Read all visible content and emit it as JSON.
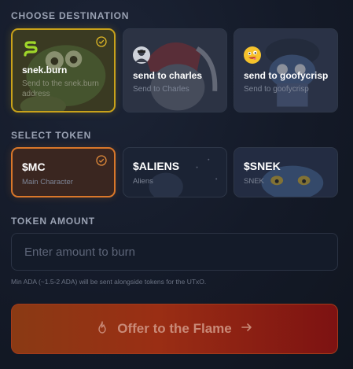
{
  "destination": {
    "section_label": "CHOOSE DESTINATION",
    "cards": [
      {
        "title": "snek.burn",
        "subtitle": "Send to the snek.burn address",
        "selected": true,
        "avatar_icon": "snake-icon"
      },
      {
        "title": "send to charles",
        "subtitle": "Send to Charles",
        "selected": false,
        "avatar_icon": "charles-avatar-icon"
      },
      {
        "title": "send to goofycrisp",
        "subtitle": "Send to goofycrisp",
        "selected": false,
        "avatar_icon": "goofy-face-icon"
      }
    ]
  },
  "token": {
    "section_label": "SELECT TOKEN",
    "cards": [
      {
        "title": "$MC",
        "subtitle": "Main Character",
        "selected": true
      },
      {
        "title": "$ALIENS",
        "subtitle": "Aliens",
        "selected": false
      },
      {
        "title": "$SNEK",
        "subtitle": "SNEK",
        "selected": false
      }
    ]
  },
  "amount": {
    "section_label": "TOKEN AMOUNT",
    "placeholder": "Enter amount to burn",
    "value": "",
    "hint": "Min ADA (~1.5-2 ADA) will be sent alongside tokens for the UTxO."
  },
  "action": {
    "button_label": "Offer to the Flame",
    "icon": "flame-icon",
    "trailing_icon": "arrow-right-icon"
  },
  "colors": {
    "gold_selected": "#c9a21a",
    "orange_selected": "#d9772a",
    "button_gradient_start": "#8a3a14",
    "button_gradient_end": "#7d1212"
  }
}
